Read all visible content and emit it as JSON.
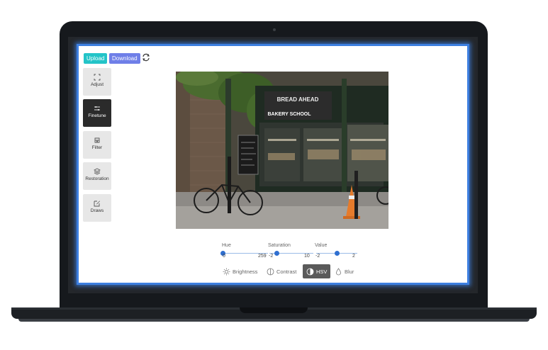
{
  "toolbar": {
    "upload_label": "Upload",
    "download_label": "Download"
  },
  "sidebar": {
    "items": [
      {
        "label": "Adjust",
        "icon": "expand-icon",
        "active": false
      },
      {
        "label": "Finetune",
        "icon": "sliders-icon",
        "active": true
      },
      {
        "label": "Filter",
        "icon": "filter-icon",
        "active": false
      },
      {
        "label": "Restoration",
        "icon": "layers-icon",
        "active": false
      },
      {
        "label": "Draws",
        "icon": "edit-icon",
        "active": false
      }
    ]
  },
  "photo": {
    "sign_text": "BREAD AHEAD",
    "sign_sub": "BAKERY SCHOOL"
  },
  "sliders": [
    {
      "label": "Hue",
      "min": "0",
      "max": "259",
      "value_fraction": 0
    },
    {
      "label": "Saturation",
      "min": "-2",
      "max": "10",
      "value_fraction": 0.17
    },
    {
      "label": "Value",
      "min": "-2",
      "max": "2",
      "value_fraction": 0.5
    }
  ],
  "tabs": [
    {
      "label": "Brightness",
      "icon": "sun-icon",
      "active": false
    },
    {
      "label": "Contrast",
      "icon": "contrast-icon",
      "active": false
    },
    {
      "label": "HSV",
      "icon": "hsv-icon",
      "active": true
    },
    {
      "label": "Blur",
      "icon": "drop-icon",
      "active": false
    }
  ],
  "colors": {
    "accent": "#2f6fd0",
    "upload": "#23c4c8",
    "download": "#6f7fe8",
    "screen_glow": "#3d7fe0"
  }
}
